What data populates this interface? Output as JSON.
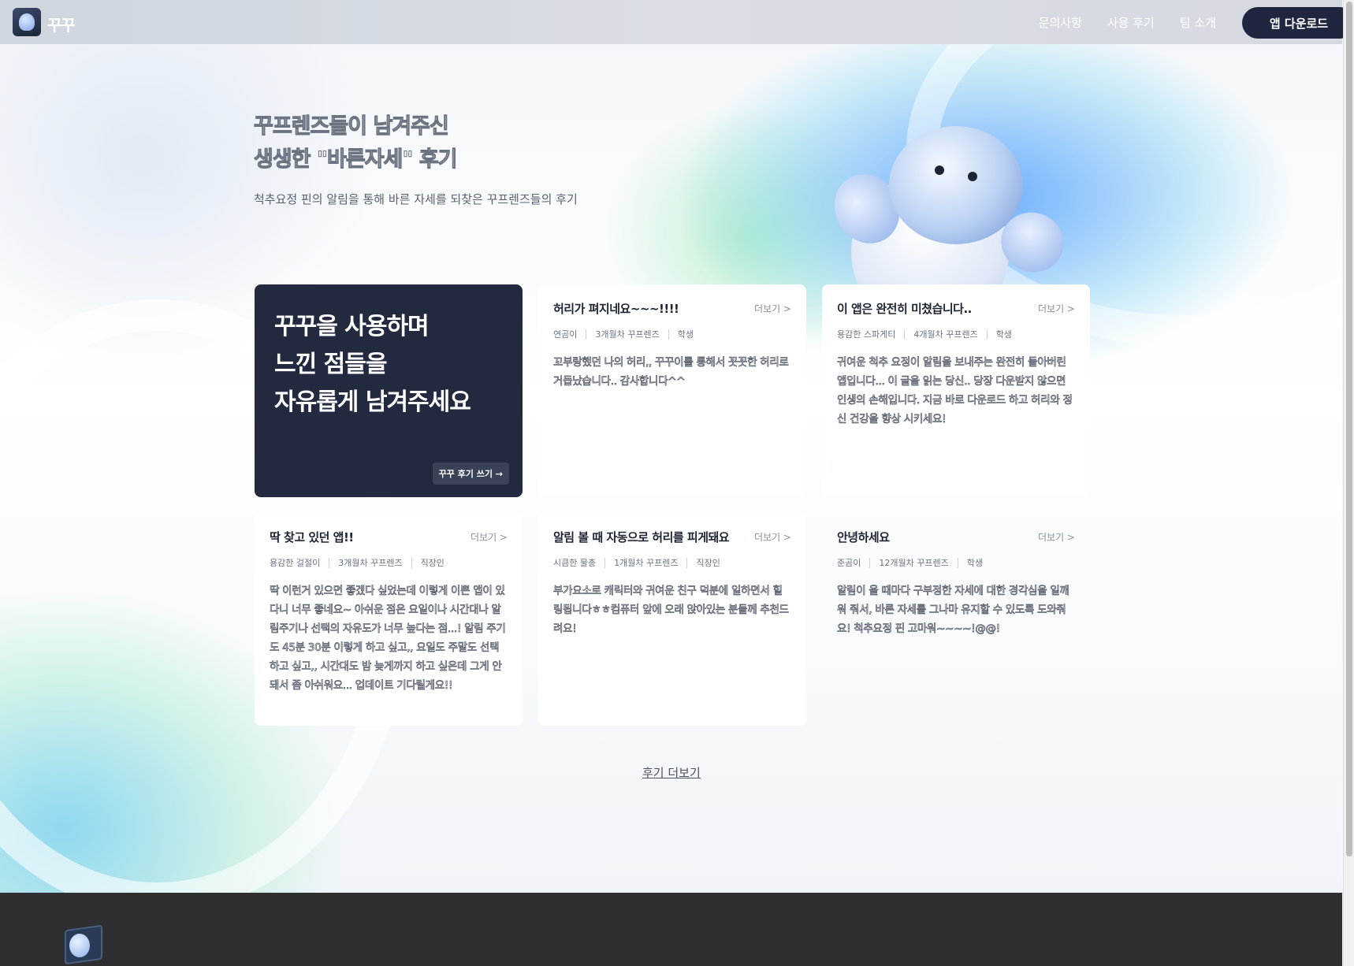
{
  "header": {
    "logo_text": "꾸꾸",
    "nav": [
      "문의사항",
      "사용 후기",
      "팀 소개"
    ],
    "download_label": "앱 다운로드"
  },
  "hero": {
    "title_line1": "꾸프렌즈들이 남겨주신",
    "title_line2": "생생한 \"바른자세\" 후기",
    "subtitle": "척추요정 핀의 알림을 통해 바른 자세를 되찾은 꾸프렌즈들의 후기"
  },
  "cta": {
    "line1": "꾸꾸을 사용하며",
    "line2": "느낀 점들을",
    "line3": "자유롭게 남겨주세요",
    "button": "꾸꾸 후기 쓰기 →"
  },
  "more_label": "더보기 >",
  "reviews": [
    {
      "title": "허리가 펴지네요~~~!!!!",
      "nickname": "연곰이",
      "period": "3개월차 꾸프렌즈",
      "job": "학생",
      "text": "꼬부랑했던 나의 허리,, 꾸꾸이를 통해서 꼿꼿한 허리로 거듭났습니다.. 감사합니다^^"
    },
    {
      "title": "이 앱은 완전히 미쳤습니다..",
      "nickname": "용감한 스파게티",
      "period": "4개월차 꾸프렌즈",
      "job": "학생",
      "text": "귀여운 척추 요정이 알림을 보내주는 완전히 돌아버린 앱입니다... 이 글을 읽는 당신.. 당장 다운받지 않으면 인생의 손해입니다. 지금 바로 다운로드 하고 허리와 정신 건강을 향상 시키세요!"
    },
    {
      "title": "딱 찾고 있던 앱!!",
      "nickname": "용감한 걸절이",
      "period": "3개월차 꾸프렌즈",
      "job": "직장인",
      "text": "딱 이런거 있으면 좋겠다 싶었는데 이렇게 이쁜 앱이 있다니 너무 좋네요~ 아쉬운 점은 요일이나 시간대나 알림주기나 선택의 자유도가 너무 높다는 점...! 알림 주기도 45분 30분 이렇게 하고 싶고,, 요일도 주말도 선택하고 싶고,, 시간대도 밤 늦게까지 하고 싶은데 그게 안돼서 좀 아쉬워요... 업데이트 기다릴게요!!"
    },
    {
      "title": "알림 볼 때 자동으로 허리를 피게돼요",
      "nickname": "시큼한 물총",
      "period": "1개월차 꾸프렌즈",
      "job": "직장인",
      "text": "부가요소로 캐릭터와 귀여운 친구 덕분에 일하면서 힐링됩니다ㅎㅎ컴퓨터 앞에 오래 앉아있는 분들께 추천드려요!"
    },
    {
      "title": "안녕하세요",
      "nickname": "준곰이",
      "period": "12개월차 꾸프렌즈",
      "job": "학생",
      "text": "알림이 올 때마다 구부정한 자세에 대한 경각심을 일깨워 줘서, 바른 자세를 그나마 유지할 수 있도록 도와줘요! 척추요정 핀 고마워~~~~!@@!"
    }
  ],
  "load_more": "후기 더보기"
}
